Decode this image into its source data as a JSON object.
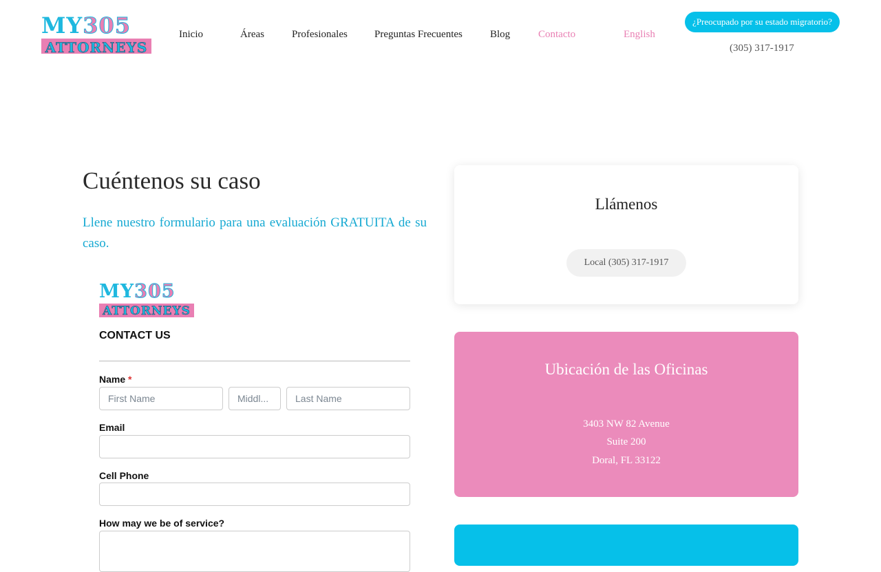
{
  "header": {
    "logo": {
      "top_left": "MY",
      "top_right": "305",
      "bottom": "ATTORNEYS"
    },
    "nav": [
      "Inicio",
      "Áreas",
      "Profesionales",
      "Preguntas Frecuentes",
      "Blog",
      "Contacto",
      "English"
    ],
    "cta_label": "¿Preocupado por su estado migratorio?",
    "phone": "(305) 317-1917"
  },
  "main": {
    "title": "Cuéntenos su caso",
    "subtitle": "Llene nuestro formulario para una evaluación GRATUITA de su caso."
  },
  "form": {
    "logo": {
      "top_left": "MY",
      "top_right": "305",
      "bottom": "ATTORNEYS"
    },
    "heading": "CONTACT US",
    "name_label": "Name",
    "required_mark": "*",
    "first_name_placeholder": "First Name",
    "middle_name_placeholder": "Middl...",
    "last_name_placeholder": "Last Name",
    "email_label": "Email",
    "cell_phone_label": "Cell Phone",
    "service_label": "How may we be of service?"
  },
  "sidebar": {
    "call": {
      "title": "Llámenos",
      "local_label": "Local (305) 317-1917"
    },
    "office": {
      "title": "Ubicación de las Oficinas",
      "address_line1": "3403 NW 82 Avenue",
      "address_line2": "Suite 200",
      "address_line3": "Doral, FL 33122"
    }
  },
  "colors": {
    "brand_pink": "#eb8bbb",
    "brand_cyan": "#06c0e9",
    "subtitle_blue": "#16a9d2"
  }
}
